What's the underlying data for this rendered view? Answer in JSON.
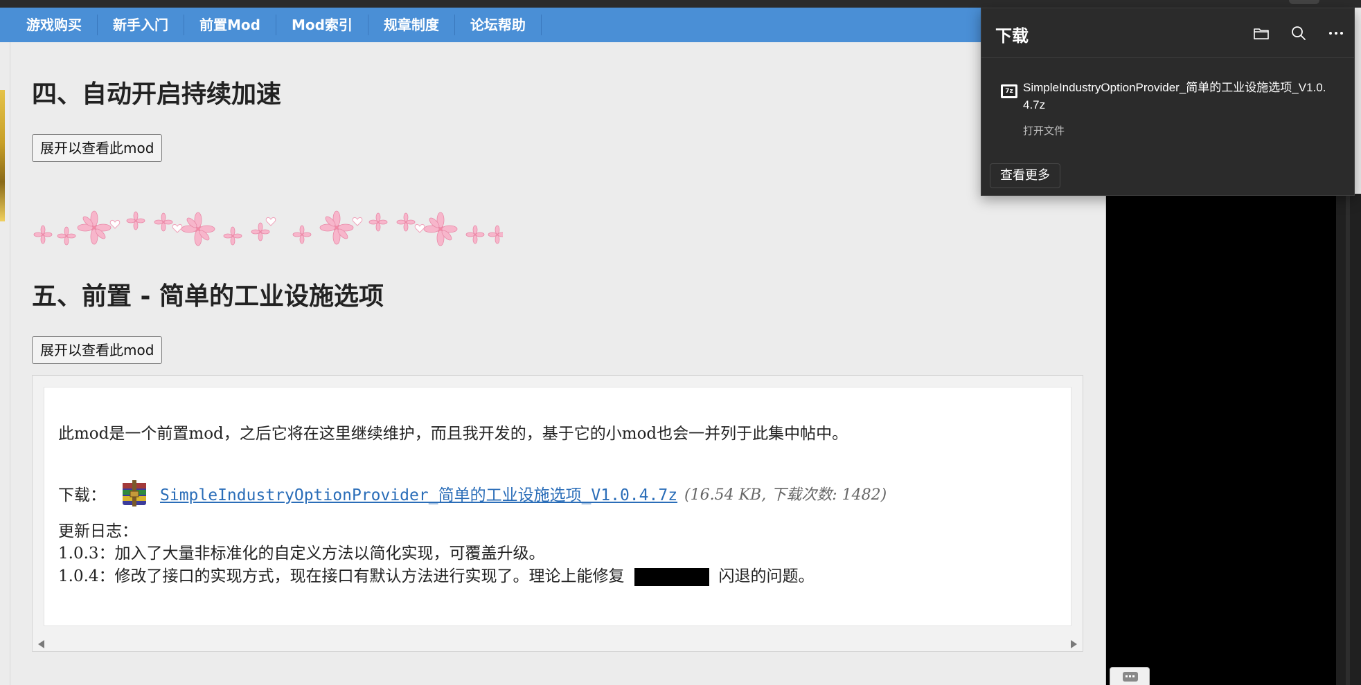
{
  "navbar": {
    "items": [
      "游戏购买",
      "新手入门",
      "前置Mod",
      "Mod索引",
      "规章制度",
      "论坛帮助"
    ]
  },
  "sections": [
    {
      "title": "四、自动开启持续加速",
      "expand_label": "展开以查看此mod"
    },
    {
      "title": "五、前置 - 简单的工业设施选项",
      "expand_label": "展开以查看此mod"
    }
  ],
  "mod_box": {
    "intro": "此mod是一个前置mod，之后它将在这里继续维护，而且我开发的，基于它的小mod也会一并列于此集中帖中。",
    "download_label": "下载：",
    "download_link": "SimpleIndustryOptionProvider_简单的工业设施选项_V1.0.4.7z",
    "download_meta": "(16.54 KB, 下载次数: 1482)",
    "changelog_title": "更新日志：",
    "changelog_1": "1.0.3：加入了大量非标准化的自定义方法以简化实现，可覆盖升级。",
    "changelog_2_pre": "1.0.4：修改了接口的实现方式，现在接口有默认方法进行实现了。理论上能修复",
    "changelog_2_post": "闪退的问题。"
  },
  "download_panel": {
    "title": "下载",
    "file_icon_label": "7z",
    "file_name": "SimpleIndustryOptionProvider_简单的工业设施选项_V1.0.4.7z",
    "file_action": "打开文件",
    "see_more": "查看更多"
  },
  "colors": {
    "navbar": "#4a8fd6",
    "link": "#2a6db8",
    "panel_bg": "#2b2b2b"
  }
}
